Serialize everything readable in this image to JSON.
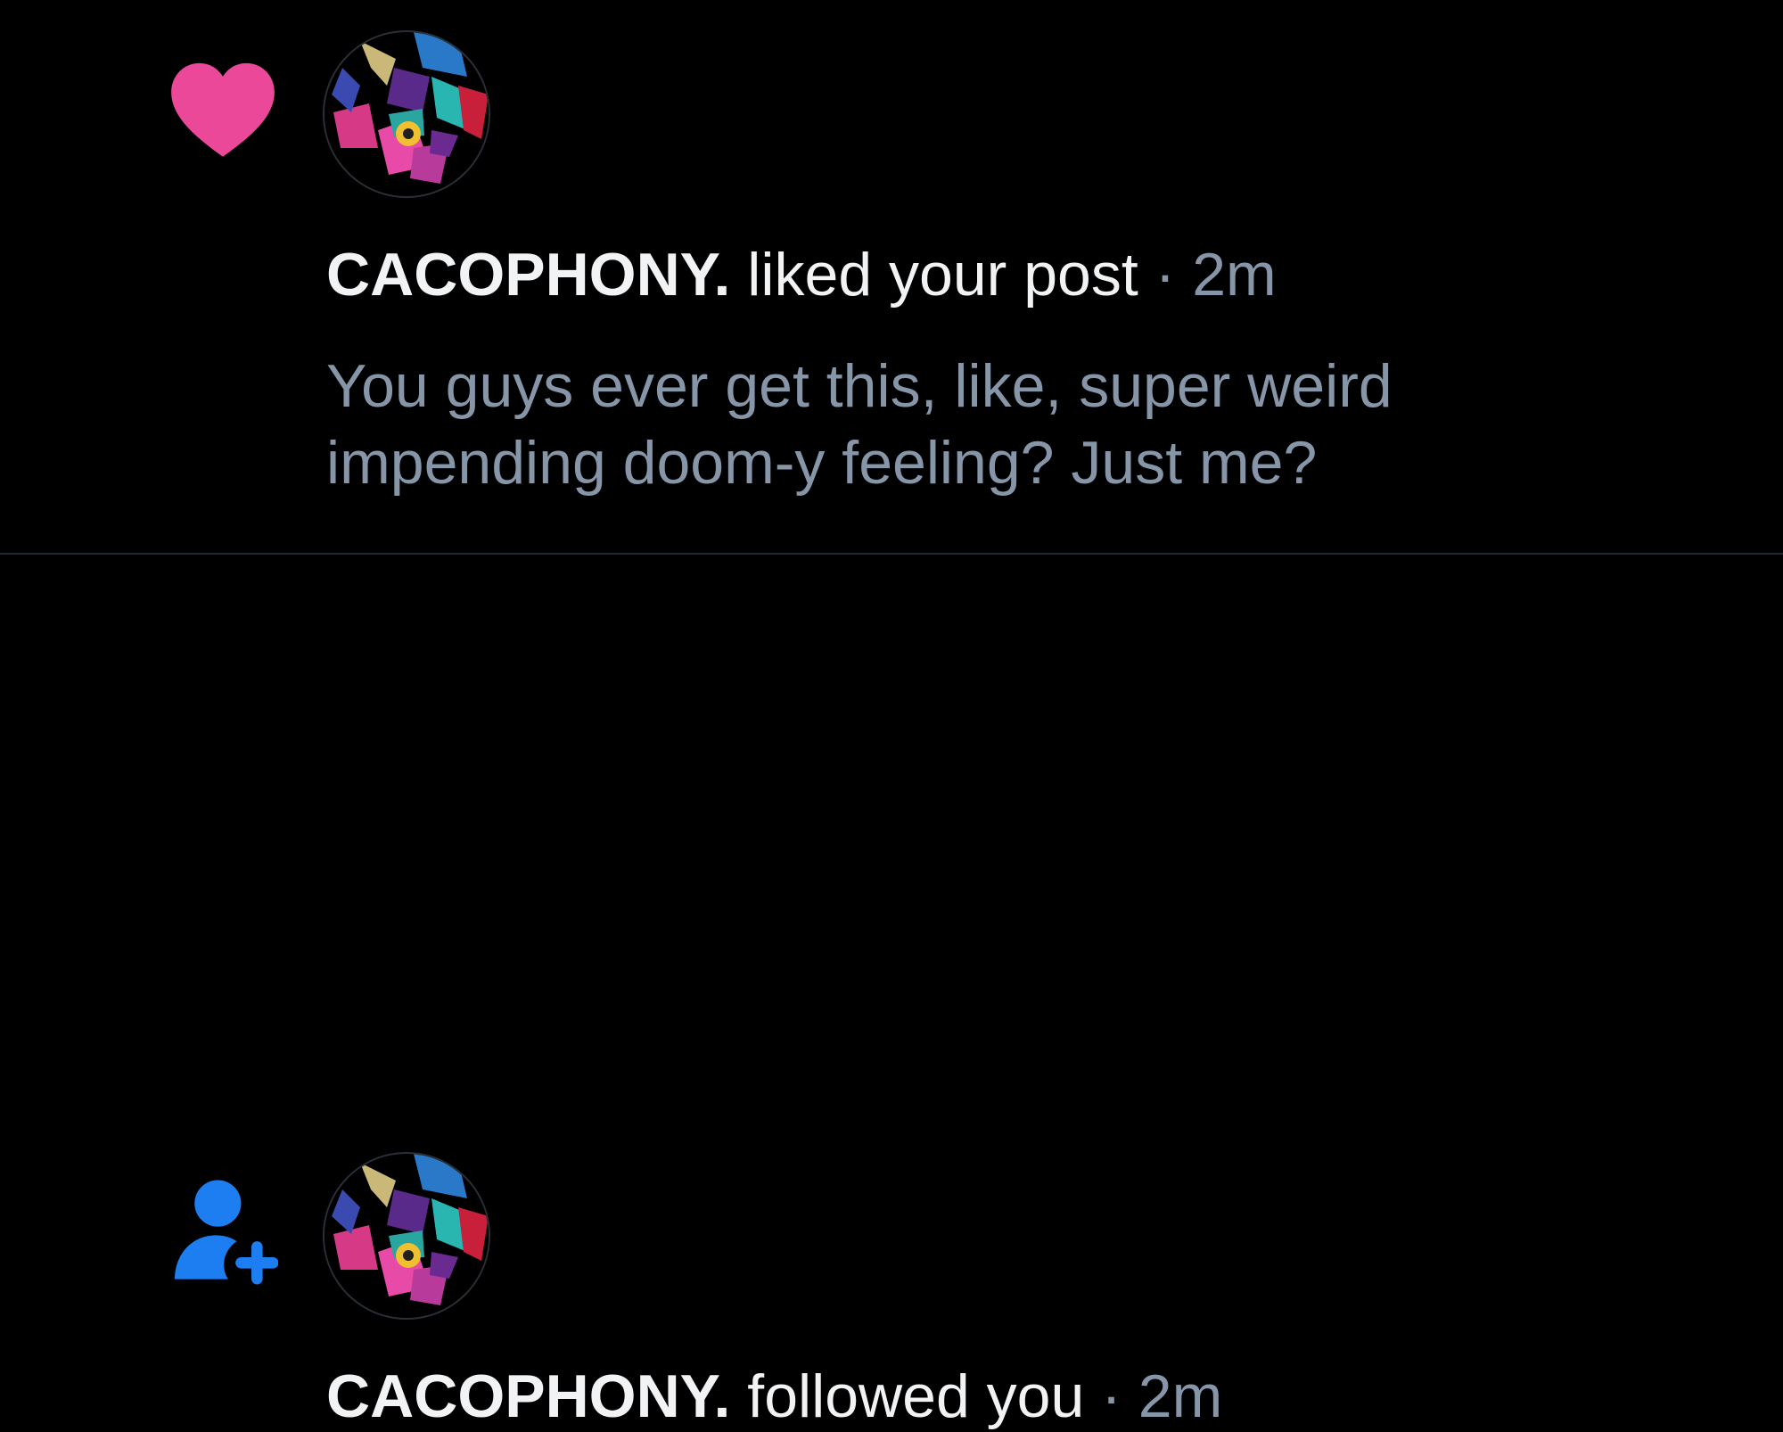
{
  "notifications": [
    {
      "type": "like",
      "icon": "heart-icon",
      "icon_color": "#ec4899",
      "author": "CACOPHONY.",
      "action": "liked your post",
      "separator": "·",
      "time": "2m",
      "post_preview": "You guys ever get this, like, super weird impending doom-y feeling?  Just me?"
    },
    {
      "type": "follow",
      "icon": "person-plus-icon",
      "icon_color": "#1d7ef2",
      "author": "CACOPHONY.",
      "action": "followed you",
      "separator": "·",
      "time": "2m"
    }
  ],
  "colors": {
    "background": "#000000",
    "divider": "#1f2a34",
    "primary_text": "#f1f3f5",
    "secondary_text": "#8696a8"
  }
}
